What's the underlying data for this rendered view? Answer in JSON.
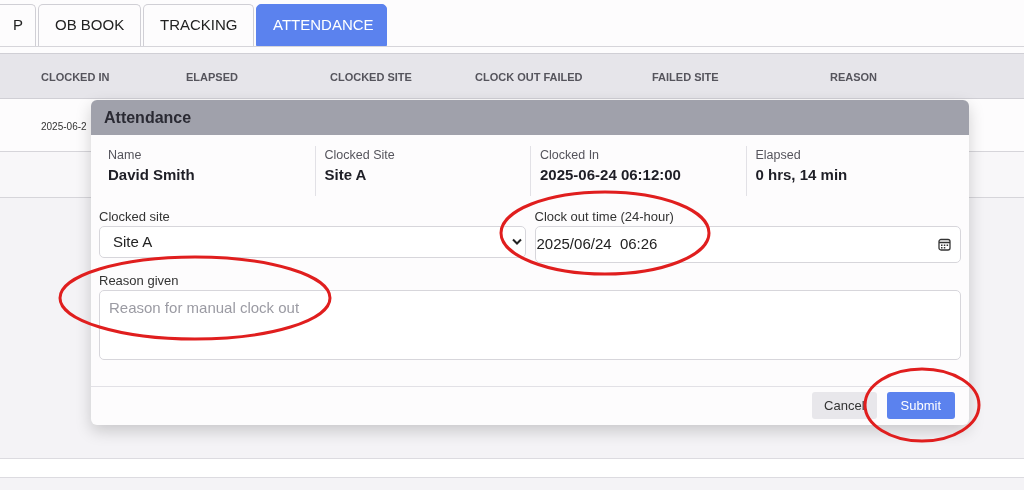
{
  "tabs": [
    {
      "label": "P",
      "selected": false
    },
    {
      "label": "OB BOOK",
      "selected": false
    },
    {
      "label": "TRACKING",
      "selected": false
    },
    {
      "label": "ATTENDANCE",
      "selected": true
    }
  ],
  "table": {
    "columns": [
      "CLOCKED IN",
      "ELAPSED",
      "CLOCKED SITE",
      "CLOCK OUT FAILED",
      "FAILED SITE",
      "REASON"
    ],
    "rows": [
      [
        "2025-06-2"
      ]
    ]
  },
  "dialog": {
    "title": "Attendance",
    "info": [
      {
        "label": "Name",
        "value": "David Smith"
      },
      {
        "label": "Clocked Site",
        "value": "Site A"
      },
      {
        "label": "Clocked In",
        "value": "2025-06-24 06:12:00"
      },
      {
        "label": "Elapsed",
        "value": "0 hrs, 14 min"
      }
    ],
    "clocked_site": {
      "label": "Clocked site",
      "value": "Site A"
    },
    "clock_out_time": {
      "label": "Clock out time (24-hour)",
      "value": "2025/06/24  06:26"
    },
    "reason": {
      "label": "Reason given",
      "placeholder": "Reason for manual clock out"
    },
    "buttons": [
      "Cancel",
      "Submit"
    ]
  }
}
